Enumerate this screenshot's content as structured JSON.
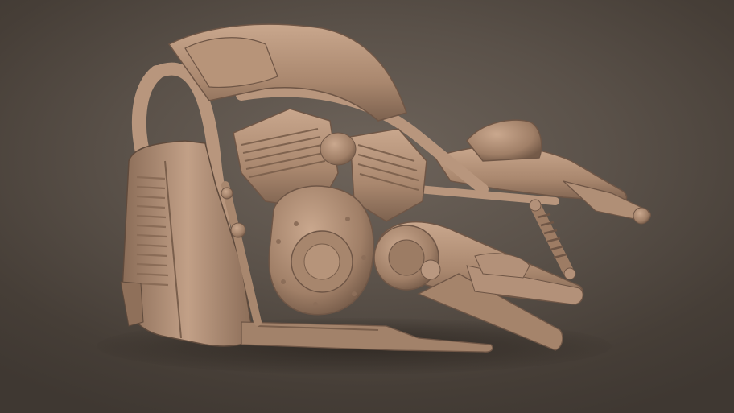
{
  "scene": {
    "subject": "motorcycle-clay-render",
    "colors": {
      "background_light": "#6e645b",
      "background_dark": "#3f3832",
      "clay_light": "#c7a48a",
      "clay_mid": "#a9876e",
      "clay_dark": "#7a5f4c",
      "clay_shadow": "#4f3d31"
    }
  }
}
